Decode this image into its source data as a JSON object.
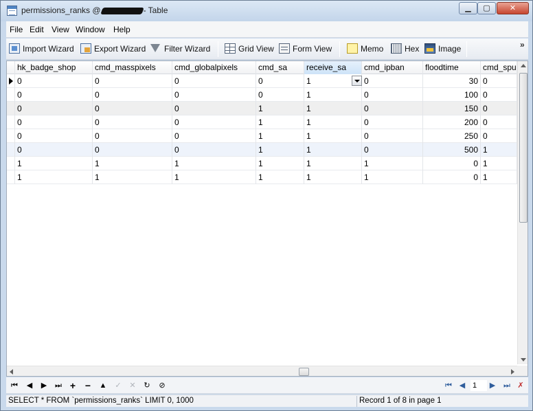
{
  "window": {
    "title_prefix": "permissions_ranks @",
    "title_suffix": "- Table",
    "min_icon": "minimize-icon",
    "max_icon": "maximize-icon",
    "close_icon": "close-icon"
  },
  "menu": [
    "File",
    "Edit",
    "View",
    "Window",
    "Help"
  ],
  "toolbar": {
    "import_wizard": "Import Wizard",
    "export_wizard": "Export Wizard",
    "filter_wizard": "Filter Wizard",
    "grid_view": "Grid View",
    "form_view": "Form View",
    "memo": "Memo",
    "hex": "Hex",
    "image": "Image",
    "more": "»"
  },
  "grid": {
    "columns": [
      "hk_badge_shop",
      "cmd_masspixels",
      "cmd_globalpixels",
      "cmd_sa",
      "receive_sa",
      "cmd_ipban",
      "floodtime",
      "cmd_spu"
    ],
    "active_column": "receive_sa",
    "rows": [
      [
        "0",
        "0",
        "0",
        "0",
        "1",
        "0",
        "30",
        "0"
      ],
      [
        "0",
        "0",
        "0",
        "0",
        "1",
        "0",
        "100",
        "0"
      ],
      [
        "0",
        "0",
        "0",
        "1",
        "1",
        "0",
        "150",
        "0"
      ],
      [
        "0",
        "0",
        "0",
        "1",
        "1",
        "0",
        "200",
        "0"
      ],
      [
        "0",
        "0",
        "0",
        "1",
        "1",
        "0",
        "250",
        "0"
      ],
      [
        "0",
        "0",
        "0",
        "1",
        "1",
        "0",
        "500",
        "1"
      ],
      [
        "1",
        "1",
        "1",
        "1",
        "1",
        "1",
        "0",
        "1"
      ],
      [
        "1",
        "1",
        "1",
        "1",
        "1",
        "1",
        "0",
        "1"
      ]
    ]
  },
  "navigator": {
    "page": "1"
  },
  "status": {
    "sql": "SELECT * FROM `permissions_ranks` LIMIT 0, 1000",
    "record": "Record 1 of 8 in page 1"
  }
}
